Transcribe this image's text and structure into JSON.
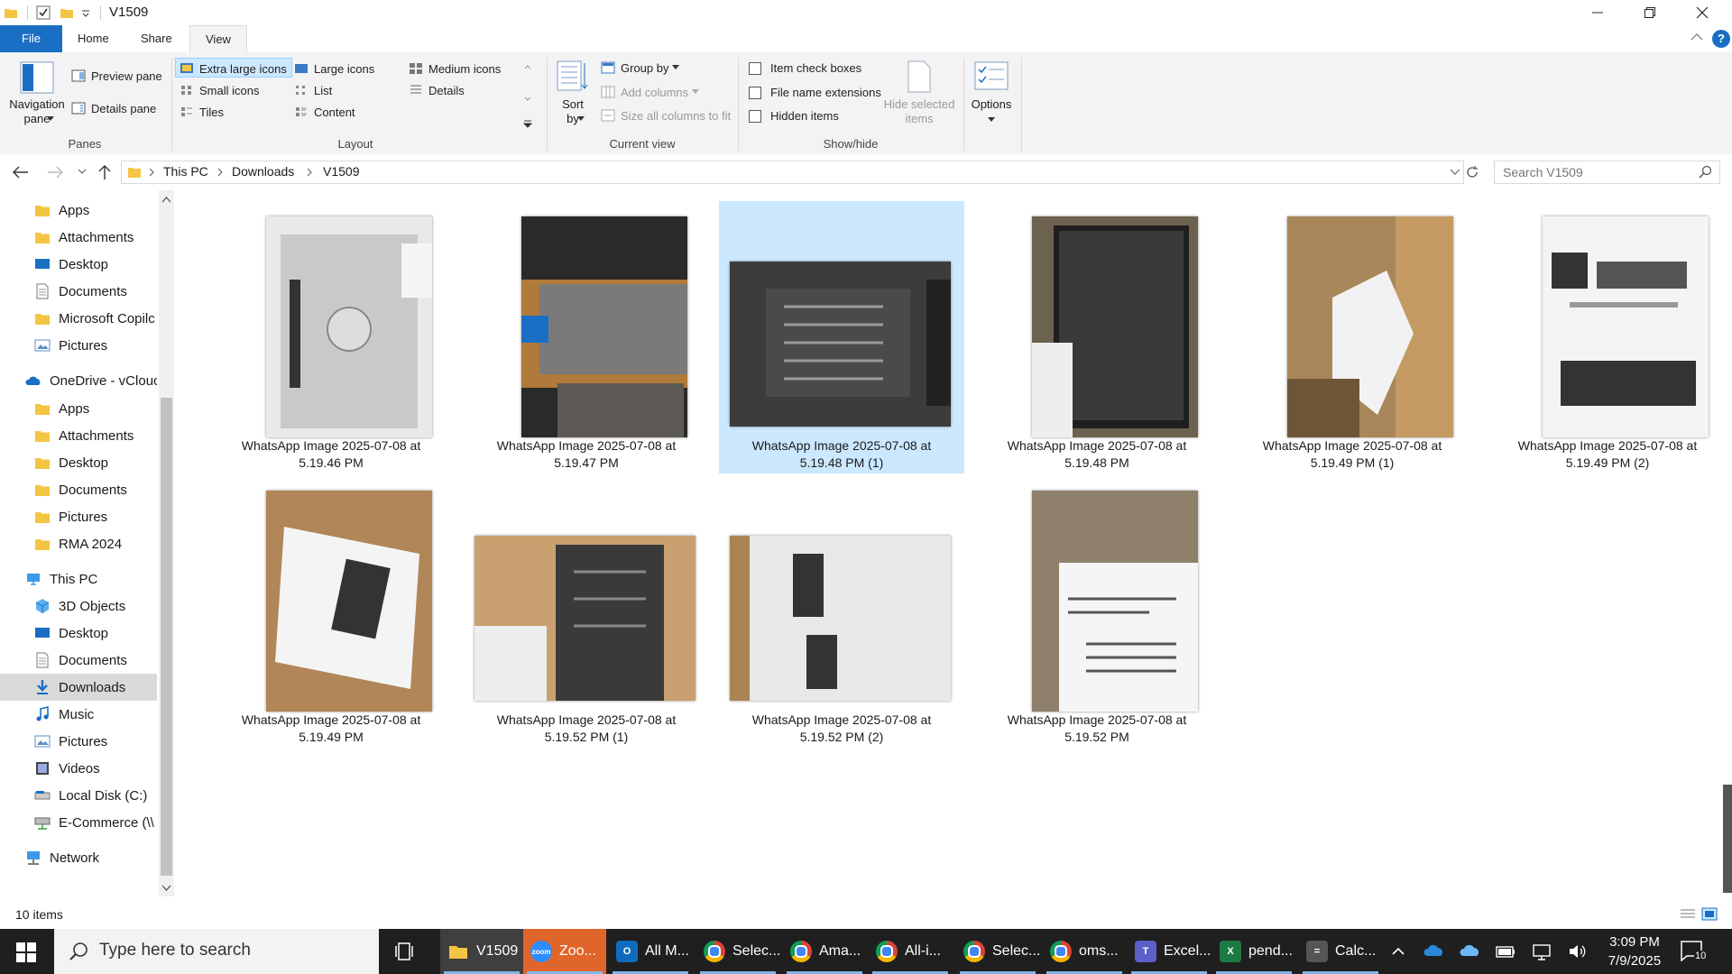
{
  "window": {
    "title": "V1509",
    "quick_access_icons": [
      "folder-icon",
      "properties-checkbox-icon",
      "new-folder-icon",
      "customize-dropdown-icon"
    ],
    "help_label": "?"
  },
  "ribbon_tabs": [
    {
      "label": "File"
    },
    {
      "label": "Home"
    },
    {
      "label": "Share"
    },
    {
      "label": "View",
      "active": true
    }
  ],
  "ribbon": {
    "panes": {
      "group_label": "Panes",
      "navigation_pane": "Navigation\npane",
      "preview_pane": "Preview pane",
      "details_pane": "Details pane"
    },
    "layout": {
      "group_label": "Layout",
      "items": [
        {
          "label": "Extra large icons",
          "selected": true
        },
        {
          "label": "Large icons"
        },
        {
          "label": "Medium icons"
        },
        {
          "label": "Small icons"
        },
        {
          "label": "List"
        },
        {
          "label": "Details"
        },
        {
          "label": "Tiles"
        },
        {
          "label": "Content"
        }
      ]
    },
    "current_view": {
      "group_label": "Current view",
      "sort_by": "Sort\nby",
      "group_by": "Group by",
      "add_columns": "Add columns",
      "size_all_columns": "Size all columns to fit"
    },
    "show_hide": {
      "group_label": "Show/hide",
      "item_check_boxes": "Item check boxes",
      "file_name_extensions": "File name extensions",
      "hidden_items": "Hidden items",
      "hide_selected_items": "Hide selected\nitems"
    },
    "options": "Options"
  },
  "address": {
    "crumbs": [
      "This PC",
      "Downloads",
      "V1509"
    ],
    "search_placeholder": "Search V1509"
  },
  "nav_pane": {
    "items": [
      {
        "label": "Apps",
        "icon": "folder-icon"
      },
      {
        "label": "Attachments",
        "icon": "folder-icon"
      },
      {
        "label": "Desktop",
        "icon": "desktop-icon"
      },
      {
        "label": "Documents",
        "icon": "documents-icon"
      },
      {
        "label": "Microsoft Copilc",
        "icon": "folder-icon"
      },
      {
        "label": "Pictures",
        "icon": "pictures-icon"
      },
      {
        "label": "OneDrive - vClouc",
        "icon": "onedrive-icon"
      },
      {
        "label": "Apps",
        "icon": "folder-icon"
      },
      {
        "label": "Attachments",
        "icon": "folder-icon"
      },
      {
        "label": "Desktop",
        "icon": "folder-icon"
      },
      {
        "label": "Documents",
        "icon": "folder-icon"
      },
      {
        "label": "Pictures",
        "icon": "folder-icon"
      },
      {
        "label": "RMA 2024",
        "icon": "folder-icon"
      },
      {
        "label": "This PC",
        "icon": "this-pc-icon"
      },
      {
        "label": "3D Objects",
        "icon": "3d-objects-icon"
      },
      {
        "label": "Desktop",
        "icon": "desktop-icon"
      },
      {
        "label": "Documents",
        "icon": "documents-icon"
      },
      {
        "label": "Downloads",
        "icon": "downloads-icon",
        "selected": true
      },
      {
        "label": "Music",
        "icon": "music-icon"
      },
      {
        "label": "Pictures",
        "icon": "pictures-icon"
      },
      {
        "label": "Videos",
        "icon": "videos-icon"
      },
      {
        "label": "Local Disk (C:)",
        "icon": "local-disk-icon"
      },
      {
        "label": "E-Commerce (\\\\",
        "icon": "network-drive-icon"
      },
      {
        "label": "Network",
        "icon": "network-icon"
      }
    ]
  },
  "files": [
    {
      "name": "WhatsApp Image 2025-07-08 at 5.19.46 PM",
      "line1": "WhatsApp Image 2025-07-08 at",
      "line2": "5.19.46 PM",
      "subject": "monitor-back-stand-mount"
    },
    {
      "name": "WhatsApp Image 2025-07-08 at 5.19.47 PM",
      "line1": "WhatsApp Image 2025-07-08 at",
      "line2": "5.19.47 PM",
      "subject": "monitor-ports-closeup"
    },
    {
      "name": "WhatsApp Image 2025-07-08 at 5.19.48 PM (1)",
      "line1": "WhatsApp Image 2025-07-08 at",
      "line2": "5.19.48 PM (1)",
      "subject": "power-adapter-label",
      "selected": true
    },
    {
      "name": "WhatsApp Image 2025-07-08 at 5.19.48 PM",
      "line1": "WhatsApp Image 2025-07-08 at",
      "line2": "5.19.48 PM",
      "subject": "monitor-front-screen"
    },
    {
      "name": "WhatsApp Image 2025-07-08 at 5.19.49 PM (1)",
      "line1": "WhatsApp Image 2025-07-08 at",
      "line2": "5.19.49 PM (1)",
      "subject": "box-with-packing-wrap"
    },
    {
      "name": "WhatsApp Image 2025-07-08 at 5.19.49 PM (2)",
      "line1": "WhatsApp Image 2025-07-08 at",
      "line2": "5.19.49 PM (2)",
      "subject": "shipping-label-barcodes"
    },
    {
      "name": "WhatsApp Image 2025-07-08 at 5.19.49 PM",
      "line1": "WhatsApp Image 2025-07-08 at",
      "line2": "5.19.49 PM",
      "subject": "box-barcode-label"
    },
    {
      "name": "WhatsApp Image 2025-07-08 at 5.19.52 PM (1)",
      "line1": "WhatsApp Image 2025-07-08 at",
      "line2": "5.19.52 PM (1)",
      "subject": "power-adapter-on-box"
    },
    {
      "name": "WhatsApp Image 2025-07-08 at 5.19.52 PM (2)",
      "line1": "WhatsApp Image 2025-07-08 at",
      "line2": "5.19.52 PM (2)",
      "subject": "barcode-sticker-white-box"
    },
    {
      "name": "WhatsApp Image 2025-07-08 at 5.19.52 PM",
      "line1": "WhatsApp Image 2025-07-08 at",
      "line2": "5.19.52 PM",
      "subject": "return-shipping-label"
    }
  ],
  "status": {
    "count": "10 items"
  },
  "taskbar": {
    "search_placeholder": "Type here to search",
    "apps": [
      {
        "label": "V1509",
        "icon": "file-explorer-icon",
        "color": "#f4c542",
        "active": true
      },
      {
        "label": "Zoo...",
        "icon": "zoom-icon",
        "color": "#2d8cff",
        "glyph": "zoom"
      },
      {
        "label": "All M...",
        "icon": "outlook-icon",
        "color": "#0f6cbd",
        "glyph": "O"
      },
      {
        "label": "Selec...",
        "icon": "chrome-icon",
        "color": "#db4437"
      },
      {
        "label": "Ama...",
        "icon": "chrome-icon",
        "color": "#db4437"
      },
      {
        "label": "All-i...",
        "icon": "chrome-icon",
        "color": "#db4437"
      },
      {
        "label": "Selec...",
        "icon": "chrome-icon",
        "color": "#db4437"
      },
      {
        "label": "oms...",
        "icon": "chrome-icon",
        "color": "#db4437"
      },
      {
        "label": "Excel...",
        "icon": "teams-icon",
        "color": "#5b5fc7",
        "glyph": "T"
      },
      {
        "label": "pend...",
        "icon": "excel-icon",
        "color": "#1d7a45",
        "glyph": "X"
      },
      {
        "label": "Calc...",
        "icon": "calculator-icon",
        "color": "#555555",
        "glyph": "="
      }
    ],
    "time": "3:09 PM",
    "date": "7/9/2025",
    "notification_count": "10"
  },
  "colors": {
    "accent": "#1a6fc4",
    "selection": "#cce8ff",
    "taskbar": "#1f1f1f"
  }
}
